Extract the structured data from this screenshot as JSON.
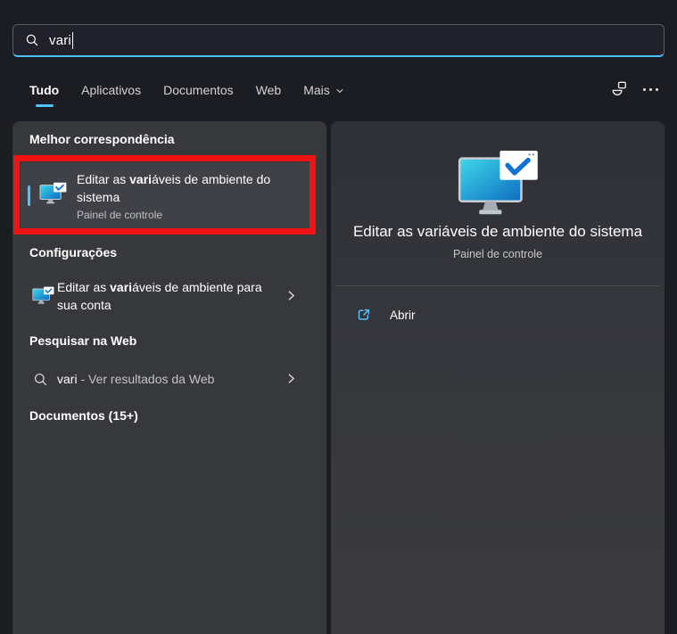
{
  "search": {
    "value": "vari"
  },
  "tabs": {
    "items": [
      {
        "label": "Tudo",
        "active": true
      },
      {
        "label": "Aplicativos",
        "active": false
      },
      {
        "label": "Documentos",
        "active": false
      },
      {
        "label": "Web",
        "active": false
      },
      {
        "label": "Mais",
        "active": false,
        "has_dropdown": true
      }
    ]
  },
  "sections": {
    "best_match": "Melhor correspondência",
    "settings": "Configurações",
    "web": "Pesquisar na Web",
    "documents": "Documentos (15+)"
  },
  "best_match_item": {
    "title_pre": "Editar as ",
    "title_match": "vari",
    "title_rest": "áveis de ambiente do sistema",
    "subtitle": "Painel de controle"
  },
  "settings_item": {
    "title_pre": "Editar as ",
    "title_match": "vari",
    "title_rest": "áveis de ambiente para sua conta"
  },
  "web_item": {
    "query": "vari",
    "suffix": " - Ver resultados da Web"
  },
  "preview": {
    "title": "Editar as variáveis de ambiente do sistema",
    "subtitle": "Painel de controle",
    "open_label": "Abrir"
  },
  "icons": {
    "search": "search-icon",
    "account": "account-icon",
    "more": "more-options-icon",
    "app": "environment-variables-app-icon",
    "chevron": "chevron-right-icon",
    "open": "open-external-icon"
  },
  "colors": {
    "accent": "#4cc2ff",
    "annotation": "#ee1414",
    "background": "#1c1d23",
    "panel": "#37383c",
    "highlight_item": "#404147"
  }
}
